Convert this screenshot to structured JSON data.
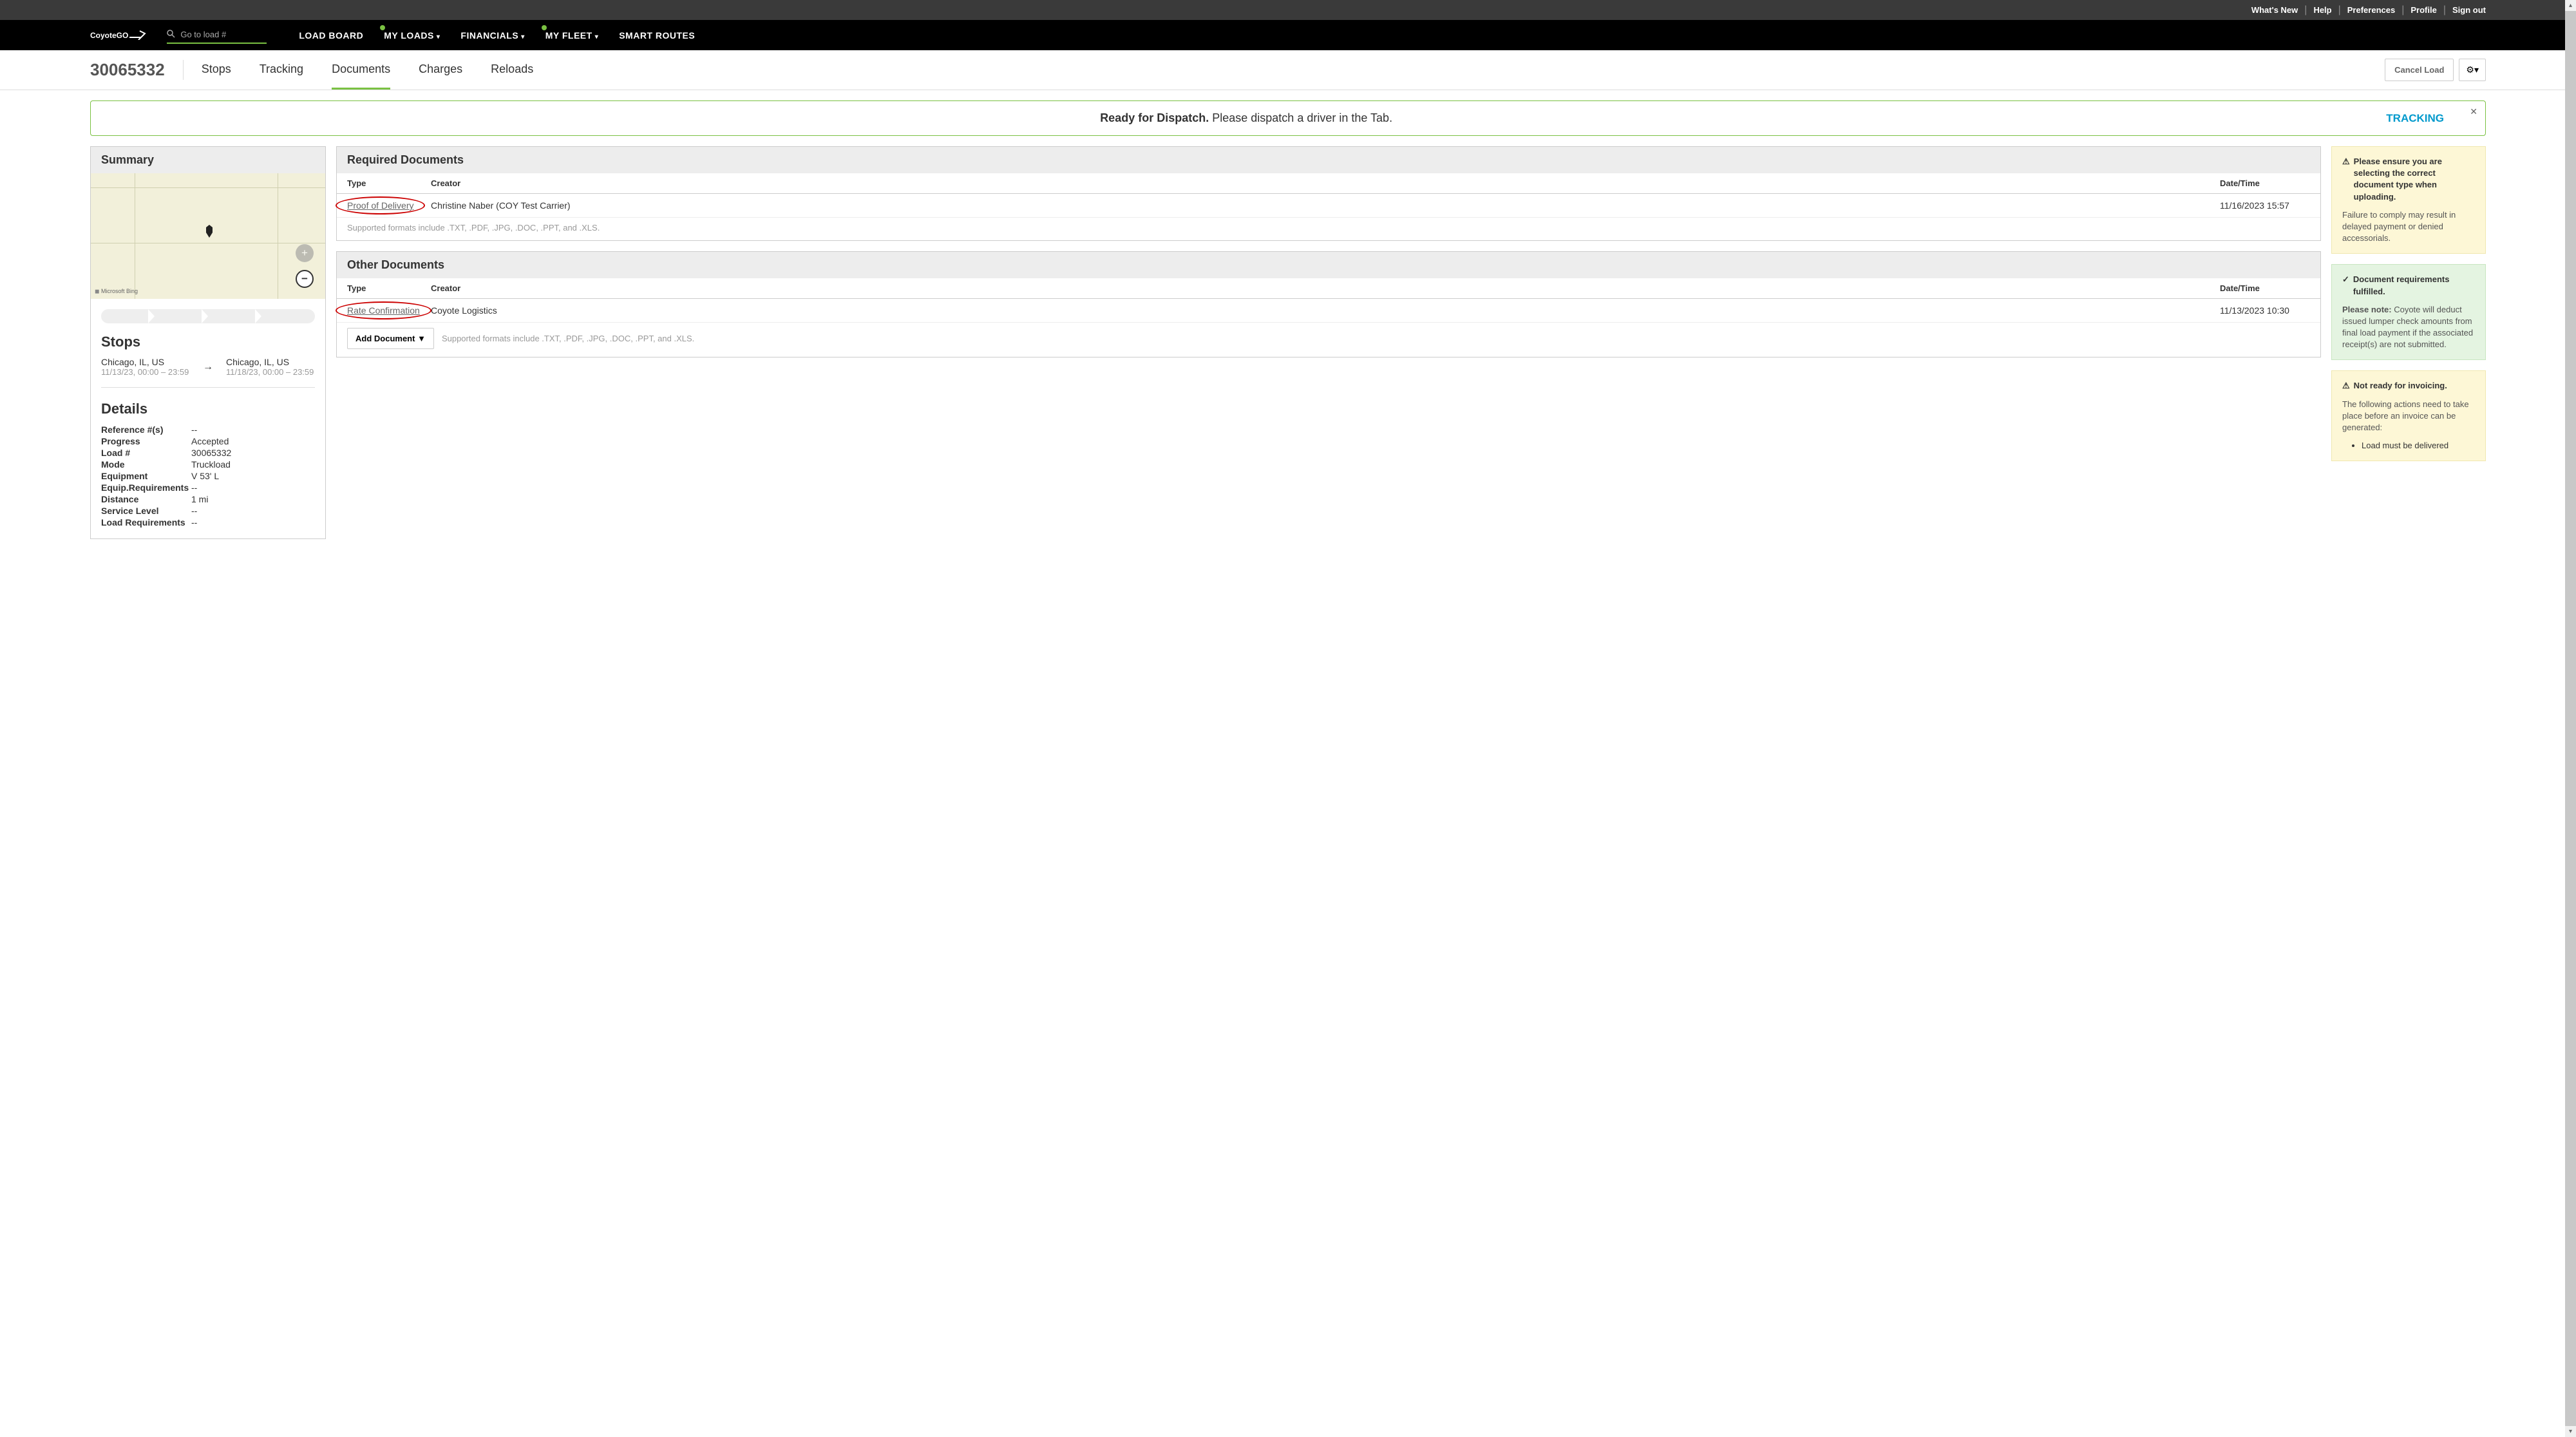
{
  "utilNav": {
    "whatsNew": "What's New",
    "help": "Help",
    "preferences": "Preferences",
    "profile": "Profile",
    "signOut": "Sign out"
  },
  "logo": "CoyoteGO",
  "search": {
    "placeholder": "Go to load #"
  },
  "mainNav": {
    "loadBoard": "LOAD BOARD",
    "myLoads": "MY LOADS",
    "financials": "FINANCIALS",
    "myFleet": "MY FLEET",
    "smartRoutes": "SMART ROUTES"
  },
  "loadId": "30065332",
  "loadTabs": {
    "stops": "Stops",
    "tracking": "Tracking",
    "documents": "Documents",
    "charges": "Charges",
    "reloads": "Reloads"
  },
  "cancelLoad": "Cancel Load",
  "banner": {
    "bold": "Ready for Dispatch.",
    "rest": " Please dispatch a driver in the Tab.",
    "link": "TRACKING"
  },
  "summary": {
    "title": "Summary",
    "mapAttr": "Microsoft Bing",
    "stopsTitle": "Stops",
    "stop1": {
      "loc": "Chicago, IL, US",
      "time": "11/13/23, 00:00 – 23:59"
    },
    "stop2": {
      "loc": "Chicago, IL, US",
      "time": "11/18/23, 00:00 – 23:59"
    },
    "detailsTitle": "Details",
    "details": [
      {
        "label": "Reference #(s)",
        "value": "--"
      },
      {
        "label": "Progress",
        "value": "Accepted"
      },
      {
        "label": "Load #",
        "value": "30065332"
      },
      {
        "label": "Mode",
        "value": "Truckload"
      },
      {
        "label": "Equipment",
        "value": "V 53' L"
      },
      {
        "label": "Equip.Requirements",
        "value": "--"
      },
      {
        "label": "Distance",
        "value": "1 mi"
      },
      {
        "label": "Service Level",
        "value": "--"
      },
      {
        "label": "Load Requirements",
        "value": "--"
      }
    ]
  },
  "requiredDocs": {
    "title": "Required Documents",
    "headers": {
      "type": "Type",
      "creator": "Creator",
      "date": "Date/Time"
    },
    "rows": [
      {
        "type": "Proof of Delivery",
        "creator": "Christine Naber (COY Test Carrier)",
        "date": "11/16/2023 15:57"
      }
    ],
    "formats": "Supported formats include .TXT, .PDF, .JPG, .DOC, .PPT, and .XLS."
  },
  "otherDocs": {
    "title": "Other Documents",
    "headers": {
      "type": "Type",
      "creator": "Creator",
      "date": "Date/Time"
    },
    "rows": [
      {
        "type": "Rate Confirmation",
        "creator": "Coyote Logistics",
        "date": "11/13/2023 10:30"
      }
    ],
    "addDoc": "Add Document",
    "formats": "Supported formats include .TXT, .PDF, .JPG, .DOC, .PPT, and .XLS."
  },
  "alerts": {
    "warn1": {
      "title": "Please ensure you are selecting the correct document type when uploading.",
      "body": "Failure to comply may result in delayed payment or denied accessorials."
    },
    "success": {
      "title": "Document requirements fulfilled.",
      "noteLabel": "Please note:",
      "body": " Coyote will deduct issued lumper check amounts from final load payment if the associated receipt(s) are not submitted."
    },
    "warn2": {
      "title": "Not ready for invoicing.",
      "body": "The following actions need to take place before an invoice can be generated:",
      "item": "Load must be delivered"
    }
  }
}
